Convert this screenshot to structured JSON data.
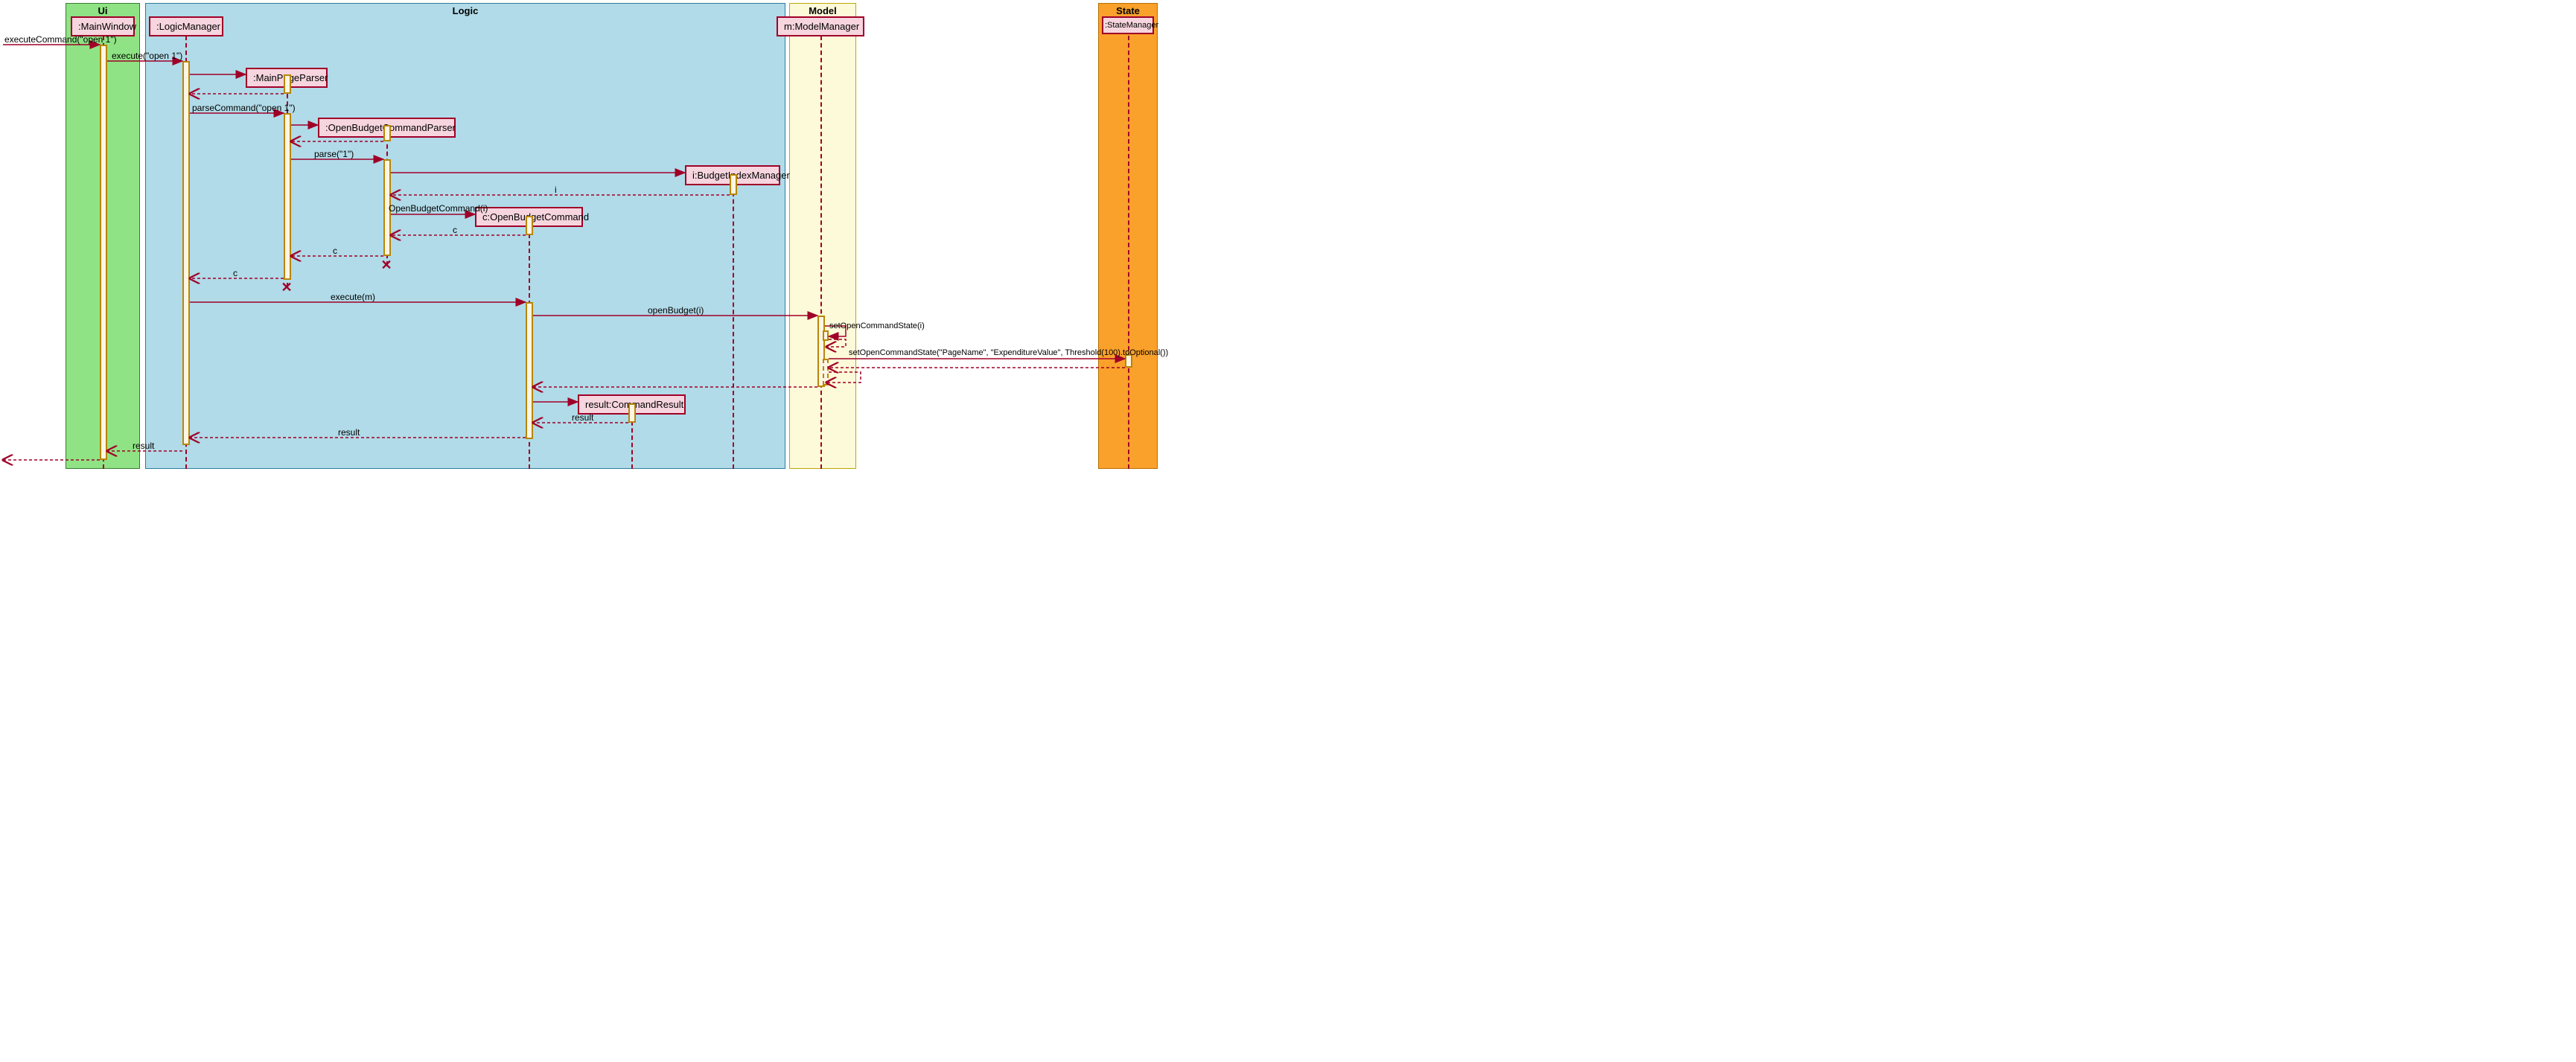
{
  "modules": {
    "ui": {
      "label": "Ui"
    },
    "logic": {
      "label": "Logic"
    },
    "model": {
      "label": "Model"
    },
    "state": {
      "label": "State"
    }
  },
  "participants": {
    "mainwindow": {
      "label": ":MainWindow"
    },
    "logicmanager": {
      "label": ":LogicManager"
    },
    "mainpageparser": {
      "label": ":MainPageParser"
    },
    "openbudgetcmdparser": {
      "label": ":OpenBudgetCommandParser"
    },
    "budgetindexmanager": {
      "label": "i:BudgetIndexManager"
    },
    "openbudgetcmd": {
      "label": "c:OpenBudgetCommand"
    },
    "commandresult": {
      "label": "result:CommandResult"
    },
    "modelmanager": {
      "label": "m:ModelManager"
    },
    "statemanager": {
      "label": ":StateManager"
    }
  },
  "messages": {
    "m1": "executeCommand(\"open 1\")",
    "m2": "execute(\"open 1\")",
    "m3": "parseCommand(\"open 1\")",
    "m4": "parse(\"1\")",
    "m5": "i",
    "m6": "OpenBudgetCommand(i)",
    "m7": "c",
    "m8": "c",
    "m9": "c",
    "m10": "execute(m)",
    "m11": "openBudget(i)",
    "m12": "setOpenCommandState(i)",
    "m13": "setOpenCommandState(\"PageName\", \"ExpenditureValue\", Threshold(100).toOptional())",
    "m14": "result",
    "m15": "result",
    "m16": "result"
  },
  "colors": {
    "uiFill": "#8FE384",
    "uiBorder": "#3a7a33",
    "logicFill": "#B1DBE8",
    "logicBorder": "#2b7d99",
    "modelFill": "#FDFAD9",
    "modelBorder": "#b9a900",
    "stateFill": "#F9A12B",
    "stateBorder": "#b86d00",
    "objFill": "#F6D5DF",
    "objBorder": "#A00028"
  }
}
